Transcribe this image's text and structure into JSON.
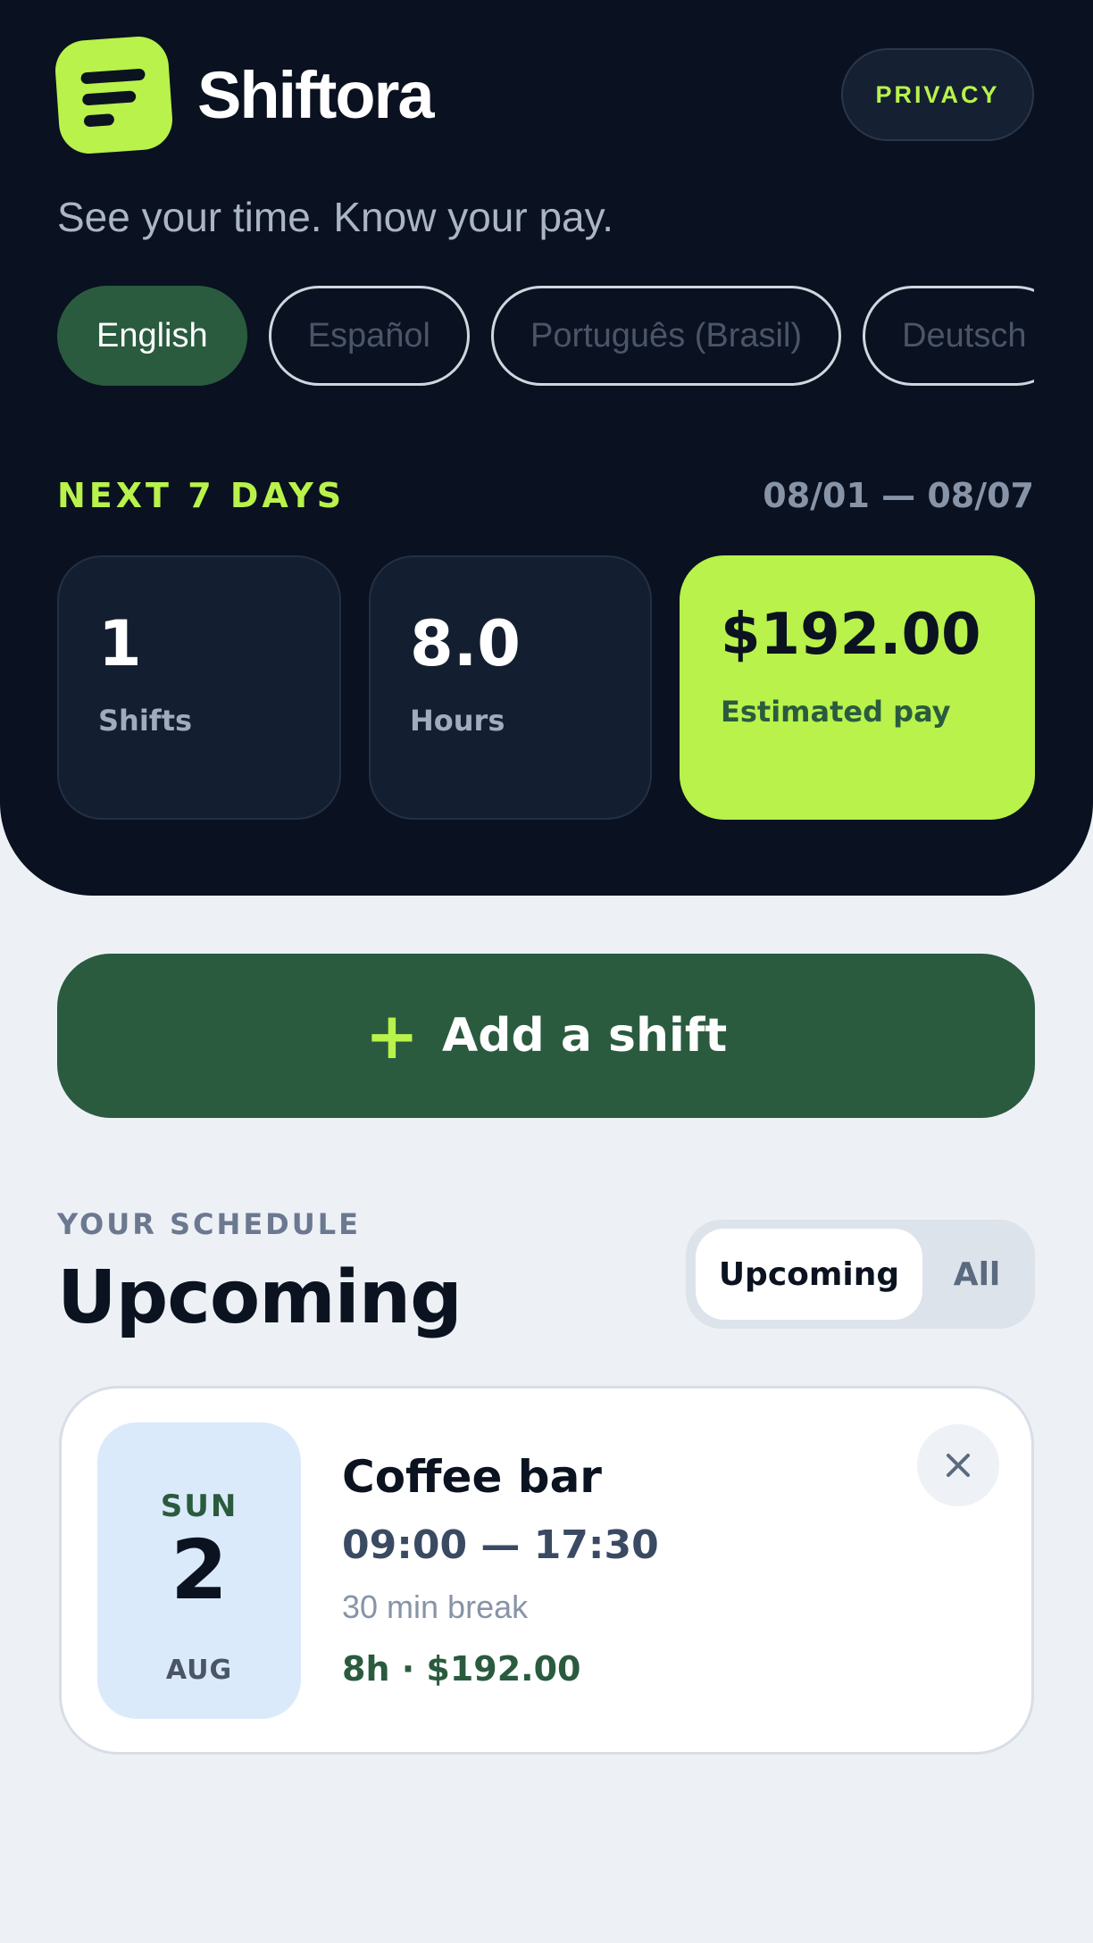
{
  "app": {
    "name": "Shiftora",
    "tagline": "See your time. Know your pay.",
    "privacy_label": "PRIVACY"
  },
  "languages": [
    {
      "label": "English",
      "selected": true
    },
    {
      "label": "Español",
      "selected": false
    },
    {
      "label": "Português (Brasil)",
      "selected": false
    },
    {
      "label": "Deutsch",
      "selected": false
    }
  ],
  "summary": {
    "range_label": "NEXT 7 DAYS",
    "range_dates": "08/01 — 08/07",
    "shifts": {
      "value": "1",
      "label": "Shifts"
    },
    "hours": {
      "value": "8.0",
      "label": "Hours"
    },
    "pay": {
      "value": "$192.00",
      "label": "Estimated pay"
    }
  },
  "actions": {
    "add_shift_icon": "+",
    "add_shift_label": "Add a shift"
  },
  "schedule": {
    "kicker": "YOUR SCHEDULE",
    "title": "Upcoming",
    "filter": {
      "upcoming": "Upcoming",
      "all": "All",
      "selected": "Upcoming"
    },
    "shifts": [
      {
        "dow": "SUN",
        "day": "2",
        "month": "AUG",
        "name": "Coffee bar",
        "time": "09:00 — 17:30",
        "break": "30 min break",
        "summary": "8h · $192.00"
      }
    ]
  },
  "colors": {
    "accent": "#b8f24b",
    "brand_green": "#2a5b3f",
    "hero_bg": "#0a1120",
    "page_bg": "#edf1f6"
  },
  "icons": {
    "logo": "list-lines-icon",
    "add": "plus-icon",
    "remove": "close-icon"
  }
}
